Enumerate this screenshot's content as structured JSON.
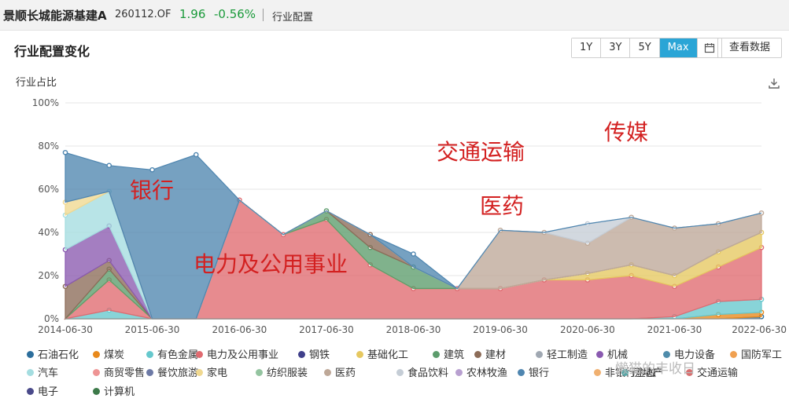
{
  "header": {
    "fund_name": "景顺长城能源基建A",
    "fund_code": "260112.OF",
    "nav": "1.96",
    "change": "-0.56%",
    "tab": "行业配置"
  },
  "panel": {
    "title": "行业配置变化",
    "ranges": [
      "1Y",
      "3Y",
      "5Y",
      "Max"
    ],
    "active_range": "Max",
    "calendar_icon": "calendar-icon",
    "view_data_label": "查看数据",
    "download_icon": "download-icon"
  },
  "watermark": "懒猫的丰收日",
  "chart_data": {
    "type": "area",
    "stacked": true,
    "ylabel": "行业占比",
    "ylim": [
      0,
      100
    ],
    "yticks": [
      "0%",
      "20%",
      "40%",
      "60%",
      "80%",
      "100%"
    ],
    "xticks": [
      "2014-06-30",
      "2015-06-30",
      "2016-06-30",
      "2017-06-30",
      "2018-06-30",
      "2019-06-30",
      "2020-06-30",
      "2021-06-30",
      "2022-06-30"
    ],
    "x": [
      "2014-06-30",
      "2014-12-31",
      "2015-06-30",
      "2015-12-31",
      "2016-06-30",
      "2016-12-31",
      "2017-06-30",
      "2017-12-31",
      "2018-06-30",
      "2018-12-31",
      "2019-06-30",
      "2019-12-31",
      "2020-06-30",
      "2020-12-31",
      "2021-06-30",
      "2021-12-31",
      "2022-06-30"
    ],
    "annotations": [
      "银行",
      "电力及公用事业",
      "交通运输",
      "医药",
      "传媒"
    ],
    "grid": true,
    "legend_position": "bottom",
    "series": [
      {
        "name": "石油石化",
        "color": "#2c6e9c",
        "values": [
          0,
          0,
          0,
          0,
          0,
          0,
          0,
          0,
          0,
          0,
          0,
          0,
          0,
          0,
          0,
          0,
          1
        ]
      },
      {
        "name": "煤炭",
        "color": "#e8891b",
        "values": [
          0,
          0,
          0,
          0,
          0,
          0,
          0,
          0,
          0,
          0,
          0,
          0,
          0,
          0,
          0,
          2,
          2
        ]
      },
      {
        "name": "有色金属",
        "color": "#66c8cd",
        "values": [
          0,
          4,
          0,
          0,
          0,
          0,
          0,
          0,
          0,
          0,
          0,
          0,
          0,
          0,
          1,
          6,
          6
        ]
      },
      {
        "name": "电力及公用事业",
        "color": "#e06a70",
        "values": [
          0,
          14,
          0,
          0,
          55,
          39,
          46,
          25,
          14,
          14,
          14,
          18,
          18,
          20,
          14,
          16,
          24
        ]
      },
      {
        "name": "钢铁",
        "color": "#3f3f8a",
        "values": [
          0,
          0,
          0,
          0,
          0,
          0,
          0,
          0,
          0,
          0,
          0,
          0,
          0,
          0,
          0,
          0,
          0
        ]
      },
      {
        "name": "基础化工",
        "color": "#e6c860",
        "values": [
          0,
          0,
          0,
          0,
          0,
          0,
          0,
          0,
          0,
          0,
          0,
          0,
          3,
          5,
          5,
          7,
          7
        ]
      },
      {
        "name": "建筑",
        "color": "#5c9c6c",
        "values": [
          0,
          5,
          0,
          0,
          0,
          0,
          4,
          8,
          10,
          0,
          0,
          0,
          0,
          0,
          0,
          0,
          0
        ]
      },
      {
        "name": "建材",
        "color": "#8c6c58",
        "values": [
          15,
          4,
          0,
          0,
          0,
          0,
          0,
          6,
          0,
          0,
          0,
          0,
          0,
          0,
          0,
          0,
          0
        ]
      },
      {
        "name": "轻工制造",
        "color": "#a0a8b2",
        "values": [
          0,
          0,
          0,
          0,
          0,
          0,
          0,
          0,
          0,
          0,
          0,
          0,
          0,
          0,
          0,
          0,
          0
        ]
      },
      {
        "name": "机械",
        "color": "#8a5ab0",
        "values": [
          17,
          16,
          0,
          0,
          0,
          0,
          0,
          0,
          0,
          0,
          0,
          0,
          0,
          0,
          0,
          0,
          0
        ]
      },
      {
        "name": "电力设备",
        "color": "#4f8cab",
        "values": [
          0,
          0,
          0,
          0,
          0,
          0,
          0,
          0,
          0,
          0,
          0,
          0,
          0,
          0,
          0,
          0,
          0
        ]
      },
      {
        "name": "国防军工",
        "color": "#f0a050",
        "values": [
          0,
          0,
          0,
          0,
          0,
          0,
          0,
          0,
          0,
          0,
          0,
          0,
          0,
          0,
          0,
          0,
          0
        ]
      },
      {
        "name": "汽车",
        "color": "#a4dde0",
        "values": [
          16,
          16,
          0,
          0,
          0,
          0,
          0,
          0,
          0,
          0,
          0,
          0,
          0,
          0,
          0,
          0,
          0
        ]
      },
      {
        "name": "商贸零售",
        "color": "#ee9494",
        "values": [
          0,
          0,
          0,
          0,
          0,
          0,
          0,
          0,
          0,
          0,
          0,
          0,
          0,
          0,
          0,
          0,
          0
        ]
      },
      {
        "name": "餐饮旅游",
        "color": "#6d7aa6",
        "values": [
          0,
          0,
          0,
          0,
          0,
          0,
          0,
          0,
          0,
          0,
          0,
          0,
          0,
          0,
          0,
          0,
          0
        ]
      },
      {
        "name": "家电",
        "color": "#f0d890",
        "values": [
          6,
          0,
          0,
          0,
          0,
          0,
          0,
          0,
          0,
          0,
          0,
          0,
          0,
          0,
          0,
          0,
          0
        ]
      },
      {
        "name": "纺织服装",
        "color": "#94c4a0",
        "values": [
          0,
          0,
          0,
          0,
          0,
          0,
          0,
          0,
          0,
          0,
          0,
          0,
          0,
          0,
          0,
          0,
          0
        ]
      },
      {
        "name": "医药",
        "color": "#bea898",
        "values": [
          0,
          0,
          0,
          0,
          0,
          0,
          0,
          0,
          0,
          0,
          27,
          22,
          14,
          22,
          22,
          13,
          9
        ]
      },
      {
        "name": "食品饮料",
        "color": "#c5cdd6",
        "values": [
          0,
          0,
          0,
          0,
          0,
          0,
          0,
          0,
          0,
          0,
          0,
          0,
          9,
          0,
          0,
          0,
          0
        ]
      },
      {
        "name": "农林牧渔",
        "color": "#b8a0d0",
        "values": [
          0,
          0,
          0,
          0,
          0,
          0,
          0,
          0,
          0,
          0,
          0,
          0,
          0,
          0,
          0,
          0,
          0
        ]
      },
      {
        "name": "银行",
        "color": "#4f86b0",
        "values": [
          23,
          12,
          69,
          76,
          0,
          0,
          0,
          0,
          6,
          0,
          0,
          0,
          0,
          0,
          0,
          0,
          0
        ]
      },
      {
        "name": "非银行金融",
        "color": "#f0b070",
        "values": [
          0,
          0,
          0,
          0,
          0,
          0,
          0,
          0,
          0,
          0,
          0,
          0,
          0,
          0,
          0,
          0,
          0
        ]
      },
      {
        "name": "房地产",
        "color": "#5aa8a8",
        "values": [
          0,
          0,
          0,
          0,
          0,
          0,
          0,
          0,
          0,
          0,
          0,
          0,
          0,
          0,
          0,
          0,
          0
        ]
      },
      {
        "name": "交通运输",
        "color": "#d87070",
        "values": [
          0,
          0,
          0,
          0,
          0,
          0,
          0,
          0,
          0,
          0,
          0,
          0,
          0,
          0,
          0,
          0,
          0
        ]
      },
      {
        "name": "电子",
        "color": "#4a4a8a",
        "values": [
          0,
          0,
          0,
          0,
          0,
          0,
          0,
          0,
          0,
          0,
          0,
          0,
          0,
          0,
          0,
          0,
          0
        ]
      },
      {
        "name": "计算机",
        "color": "#3d7a4a",
        "values": [
          0,
          0,
          0,
          0,
          0,
          0,
          0,
          0,
          0,
          0,
          0,
          0,
          0,
          0,
          0,
          0,
          0
        ]
      },
      {
        "name": "传媒",
        "color": "#806a5a",
        "values": [
          0,
          0,
          0,
          0,
          0,
          0,
          0,
          0,
          0,
          0,
          0,
          0,
          0,
          0,
          0,
          0,
          0
        ]
      }
    ]
  }
}
